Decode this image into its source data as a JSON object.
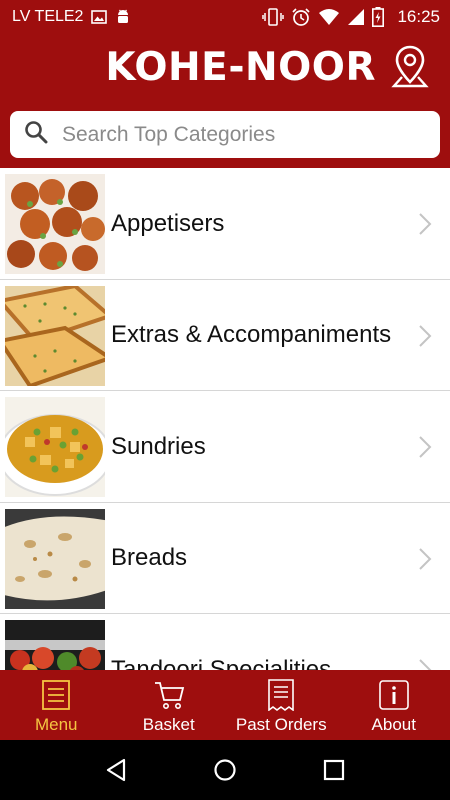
{
  "status_bar": {
    "carrier": "LV TELE2",
    "time": "16:25",
    "left_icons": [
      "image-icon",
      "android-icon"
    ],
    "right_icons": [
      "vibrate-icon",
      "alarm-icon",
      "wifi-icon",
      "signal-icon",
      "battery-icon"
    ]
  },
  "header": {
    "brand": "KOHE-NOOR",
    "location_icon": "map-pin-icon"
  },
  "search": {
    "placeholder": "Search Top Categories",
    "value": ""
  },
  "categories": [
    {
      "label": "Appetisers",
      "image": "fried-balls"
    },
    {
      "label": "Extras & Accompaniments",
      "image": "garlic-bread"
    },
    {
      "label": "Sundries",
      "image": "vegetable-curry"
    },
    {
      "label": "Breads",
      "image": "naan-bread"
    },
    {
      "label": "Tandoori Specialities",
      "image": "tandoori-skewers"
    }
  ],
  "tabs": [
    {
      "label": "Menu",
      "icon": "menu-icon",
      "active": true
    },
    {
      "label": "Basket",
      "icon": "cart-icon",
      "active": false
    },
    {
      "label": "Past Orders",
      "icon": "receipt-icon",
      "active": false
    },
    {
      "label": "About",
      "icon": "info-icon",
      "active": false
    }
  ],
  "colors": {
    "brand_red": "#9e0e0e",
    "active_tab": "#f4c542",
    "nav_bar": "#000000"
  }
}
